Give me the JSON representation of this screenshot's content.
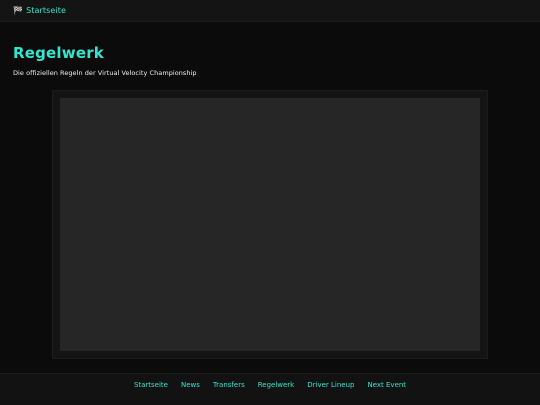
{
  "topbar": {
    "home_icon": "checkered-flag-icon",
    "home_label": "Startseite"
  },
  "main": {
    "title": "Regelwerk",
    "subtitle": "Die offiziellen Regeln der Virtual Velocity Championship"
  },
  "footer": {
    "links": [
      "Startseite",
      "News",
      "Transfers",
      "Regelwerk",
      "Driver Lineup",
      "Next Event"
    ]
  },
  "colors": {
    "accent": "#35e6cf",
    "background": "#0b0b0b",
    "viewer": "#262626"
  }
}
